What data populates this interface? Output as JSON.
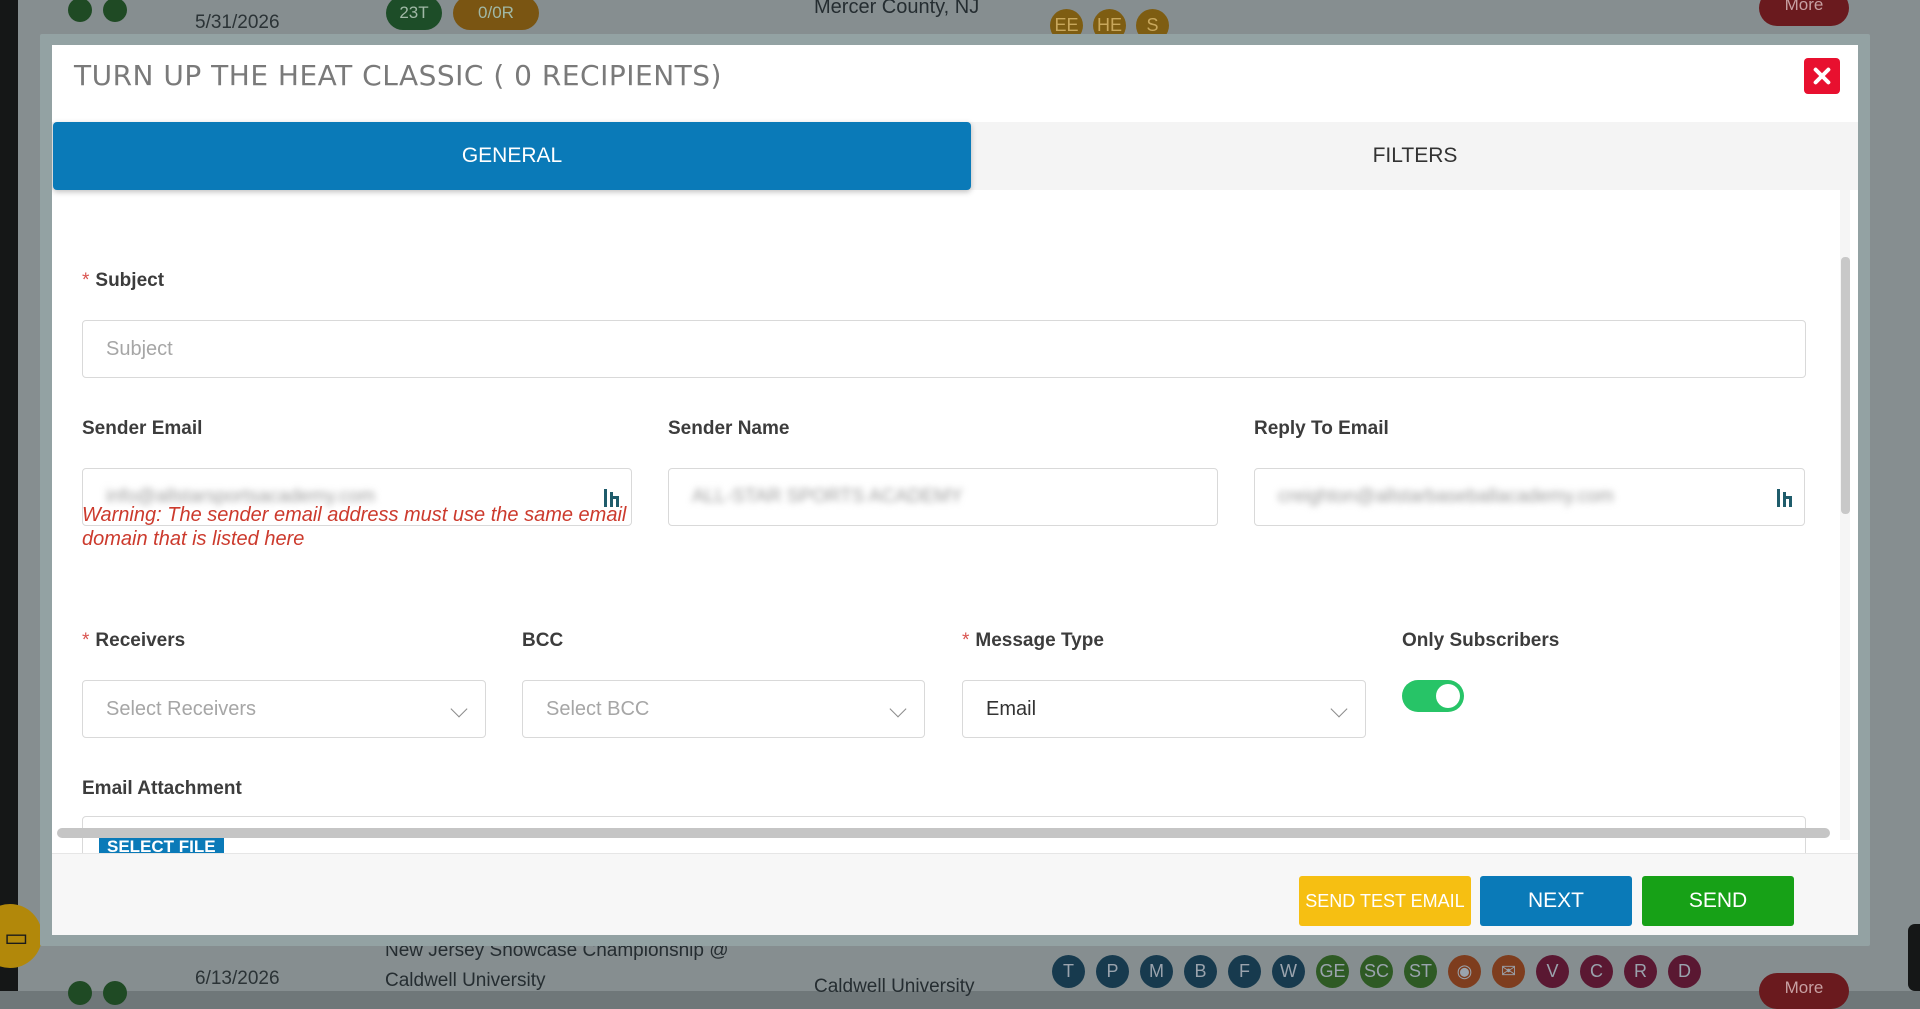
{
  "background": {
    "rows": [
      {
        "date": "5/31/2026",
        "count_badge": "23T",
        "ratio_badge": "0/0R",
        "location": "Mercer County, NJ",
        "tags_row2": [
          "EE",
          "HE",
          "S"
        ],
        "more_label": "More"
      },
      {
        "date": "6/13/2026",
        "event_name_line1": "New Jersey Showcase Championship @",
        "event_name_line2": "Caldwell University",
        "location": "Caldwell University",
        "tags": [
          "T",
          "P",
          "M",
          "B",
          "F",
          "W",
          "GE",
          "SC",
          "ST",
          "",
          "",
          "V",
          "C",
          "R",
          "D"
        ],
        "more_label": "More"
      }
    ],
    "colors": {
      "T": "#173a4e",
      "P": "#173a4e",
      "M": "#173a4e",
      "B": "#173a4e",
      "F": "#173a4e",
      "W": "#173a4e",
      "GE": "#2e5a24",
      "SC": "#2e5a24",
      "ST": "#2e5a24",
      "orange": "#7e3d1e",
      "V": "#5a1832",
      "C": "#5a1832",
      "R": "#5a1832",
      "D": "#5a1832"
    }
  },
  "modal": {
    "title": "TURN UP THE HEAT CLASSIC ( 0 RECIPIENTS)",
    "close_icon": "close-x-icon",
    "tabs": [
      {
        "label": "GENERAL",
        "active": true
      },
      {
        "label": "FILTERS",
        "active": false
      }
    ],
    "form": {
      "subject": {
        "label": "Subject",
        "required": true,
        "placeholder": "Subject",
        "value": ""
      },
      "sender_email": {
        "label": "Sender Email",
        "value": "info@allstarsportsacademy.com",
        "icon": "variable-picker-icon"
      },
      "sender_name": {
        "label": "Sender Name",
        "value": "ALL-STAR SPORTS ACADEMY"
      },
      "reply_to_email": {
        "label": "Reply To Email",
        "value": "creighton@allstarbaseballacademy.com",
        "icon": "variable-picker-icon"
      },
      "warning": "Warning: The sender email address must use the same email domain that is listed here",
      "receivers": {
        "label": "Receivers",
        "required": true,
        "placeholder": "Select Receivers"
      },
      "bcc": {
        "label": "BCC",
        "placeholder": "Select BCC"
      },
      "message_type": {
        "label": "Message Type",
        "required": true,
        "value": "Email"
      },
      "only_subscribers": {
        "label": "Only Subscribers",
        "on": true
      },
      "email_attachment": {
        "label": "Email Attachment",
        "button": "SELECT FILE"
      }
    },
    "footer": {
      "send_test_label": "SEND TEST EMAIL",
      "next_label": "NEXT",
      "send_label": "SEND"
    },
    "accent": "#0a7ab8",
    "danger": "#e8102f",
    "warning_color": "#cc3a2d",
    "toggle_on_color": "#27c467"
  }
}
